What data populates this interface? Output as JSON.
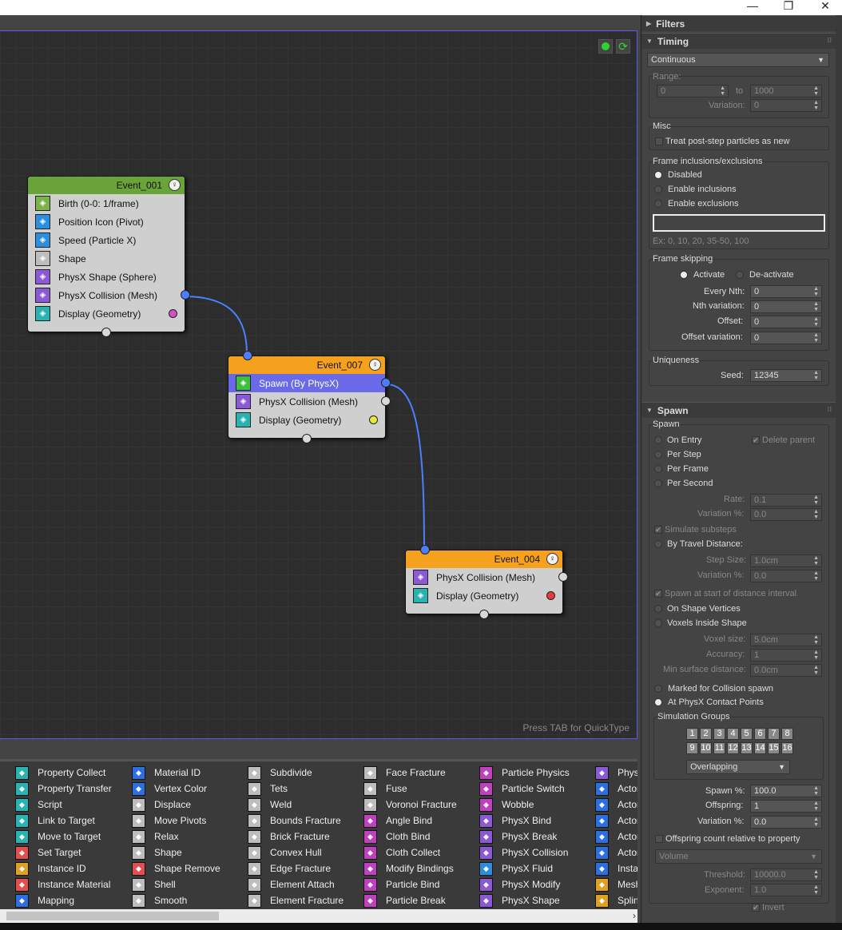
{
  "window": {
    "minimize": "—",
    "restore": "❐",
    "close": "✕"
  },
  "canvas": {
    "quicktype_hint": "Press TAB for QuickType"
  },
  "nodes": [
    {
      "id": "event_001",
      "title": "Event_001",
      "head_color": "#6aa337",
      "operators": [
        {
          "label": "Birth (0-0: 1/frame)",
          "icon": "birth-icon",
          "icon_color": "#7bb34a"
        },
        {
          "label": "Position Icon (Pivot)",
          "icon": "position-icon",
          "icon_color": "#2b8fe0"
        },
        {
          "label": "Speed (Particle X)",
          "icon": "speed-icon",
          "icon_color": "#2b8fe0"
        },
        {
          "label": "Shape",
          "icon": "shape-icon",
          "icon_color": "#bdbdbd"
        },
        {
          "label": "PhysX Shape (Sphere)",
          "icon": "physx-shape-icon",
          "icon_color": "#8b58d6"
        },
        {
          "label": "PhysX Collision (Mesh)",
          "icon": "physx-collision-icon",
          "icon_color": "#8b58d6"
        },
        {
          "label": "Display (Geometry)",
          "icon": "display-icon",
          "icon_color": "#29b2b2"
        }
      ],
      "display_color": "#d64ec9"
    },
    {
      "id": "event_007",
      "title": "Event_007",
      "head_color": "#f5a11e",
      "operators": [
        {
          "label": "Spawn (By PhysX)",
          "icon": "spawn-icon",
          "icon_color": "#3fbf3f",
          "selected": true
        },
        {
          "label": "PhysX Collision (Mesh)",
          "icon": "physx-collision-icon",
          "icon_color": "#8b58d6"
        },
        {
          "label": "Display (Geometry)",
          "icon": "display-icon",
          "icon_color": "#29b2b2"
        }
      ],
      "display_color": "#e8e83a"
    },
    {
      "id": "event_004",
      "title": "Event_004",
      "head_color": "#f5a11e",
      "operators": [
        {
          "label": "PhysX Collision (Mesh)",
          "icon": "physx-collision-icon",
          "icon_color": "#8b58d6"
        },
        {
          "label": "Display (Geometry)",
          "icon": "display-icon",
          "icon_color": "#29b2b2"
        }
      ],
      "display_color": "#e83a3a"
    }
  ],
  "depot": {
    "columns": [
      [
        {
          "label": "Property Collect",
          "c": "#2ab3b3"
        },
        {
          "label": "Property Transfer",
          "c": "#2ab3b3"
        },
        {
          "label": "Script",
          "c": "#2ab3b3"
        },
        {
          "label": "Link to Target",
          "c": "#2ab3b3"
        },
        {
          "label": "Move to Target",
          "c": "#2ab3b3"
        },
        {
          "label": "Set Target",
          "c": "#e05050"
        },
        {
          "label": "Instance ID",
          "c": "#e0a020"
        },
        {
          "label": "Instance Material",
          "c": "#e05050"
        },
        {
          "label": "Mapping",
          "c": "#2b6fe0"
        }
      ],
      [
        {
          "label": "Material ID",
          "c": "#2b6fe0"
        },
        {
          "label": "Vertex Color",
          "c": "#2b6fe0"
        },
        {
          "label": "Displace",
          "c": "#bdbdbd"
        },
        {
          "label": "Move Pivots",
          "c": "#bdbdbd"
        },
        {
          "label": "Relax",
          "c": "#bdbdbd"
        },
        {
          "label": "Shape",
          "c": "#bdbdbd"
        },
        {
          "label": "Shape Remove",
          "c": "#e05050"
        },
        {
          "label": "Shell",
          "c": "#bdbdbd"
        },
        {
          "label": "Smooth",
          "c": "#bdbdbd"
        }
      ],
      [
        {
          "label": "Subdivide",
          "c": "#bdbdbd"
        },
        {
          "label": "Tets",
          "c": "#bdbdbd"
        },
        {
          "label": "Weld",
          "c": "#bdbdbd"
        },
        {
          "label": "Bounds Fracture",
          "c": "#bdbdbd"
        },
        {
          "label": "Brick Fracture",
          "c": "#bdbdbd"
        },
        {
          "label": "Convex Hull",
          "c": "#bdbdbd"
        },
        {
          "label": "Edge Fracture",
          "c": "#bdbdbd"
        },
        {
          "label": "Element Attach",
          "c": "#bdbdbd"
        },
        {
          "label": "Element Fracture",
          "c": "#bdbdbd"
        }
      ],
      [
        {
          "label": "Face Fracture",
          "c": "#bdbdbd"
        },
        {
          "label": "Fuse",
          "c": "#bdbdbd"
        },
        {
          "label": "Voronoi Fracture",
          "c": "#bdbdbd"
        },
        {
          "label": "Angle Bind",
          "c": "#c040c0"
        },
        {
          "label": "Cloth Bind",
          "c": "#c040c0"
        },
        {
          "label": "Cloth Collect",
          "c": "#c040c0"
        },
        {
          "label": "Modify Bindings",
          "c": "#c040c0"
        },
        {
          "label": "Particle Bind",
          "c": "#c040c0"
        },
        {
          "label": "Particle Break",
          "c": "#c040c0"
        }
      ],
      [
        {
          "label": "Particle Physics",
          "c": "#c040c0"
        },
        {
          "label": "Particle Switch",
          "c": "#c040c0"
        },
        {
          "label": "Wobble",
          "c": "#c040c0"
        },
        {
          "label": "PhysX Bind",
          "c": "#8b58d6"
        },
        {
          "label": "PhysX Break",
          "c": "#8b58d6"
        },
        {
          "label": "PhysX Collision",
          "c": "#8b58d6"
        },
        {
          "label": "PhysX Fluid",
          "c": "#2b8fe0"
        },
        {
          "label": "PhysX Modify",
          "c": "#8b58d6"
        },
        {
          "label": "PhysX Shape",
          "c": "#8b58d6"
        }
      ],
      [
        {
          "label": "PhysX",
          "c": "#8b58d6"
        },
        {
          "label": "Actor",
          "c": "#2b6fe0"
        },
        {
          "label": "Actor",
          "c": "#2b6fe0"
        },
        {
          "label": "Actor",
          "c": "#2b6fe0"
        },
        {
          "label": "Actor",
          "c": "#2b6fe0"
        },
        {
          "label": "Actor",
          "c": "#2b6fe0"
        },
        {
          "label": "Instan",
          "c": "#2b6fe0"
        },
        {
          "label": "Mesh",
          "c": "#e0a020"
        },
        {
          "label": "Splin",
          "c": "#e0a020"
        }
      ]
    ],
    "scroll_right": "›"
  },
  "panel": {
    "filters": {
      "title": "Filters"
    },
    "timing": {
      "title": "Timing",
      "mode": "Continuous",
      "range_label": "Range:",
      "range_from": "0",
      "to_label": "to",
      "range_to": "1000",
      "variation_label": "Variation:",
      "variation": "0",
      "misc_label": "Misc",
      "treat_post_step": "Treat post-step particles as new",
      "frame_inc_label": "Frame inclusions/exclusions",
      "disabled": "Disabled",
      "enable_inclusions": "Enable inclusions",
      "enable_exclusions": "Enable exclusions",
      "ex_hint": "Ex: 0, 10, 20, 35-50, 100",
      "frame_skip_label": "Frame skipping",
      "activate": "Activate",
      "deactivate": "De-activate",
      "every_nth_label": "Every Nth:",
      "every_nth": "0",
      "nth_var_label": "Nth variation:",
      "nth_var": "0",
      "offset_label": "Offset:",
      "offset": "0",
      "offset_var_label": "Offset variation:",
      "offset_var": "0",
      "uniqueness_label": "Uniqueness",
      "seed_label": "Seed:",
      "seed": "12345"
    },
    "spawn": {
      "title": "Spawn",
      "group_label": "Spawn",
      "on_entry": "On Entry",
      "delete_parent": "Delete parent",
      "per_step": "Per Step",
      "per_frame": "Per Frame",
      "per_second": "Per Second",
      "rate_label": "Rate:",
      "rate": "0.1",
      "variation_pct_label": "Variation %:",
      "variation_pct": "0.0",
      "simulate_substeps": "Simulate substeps",
      "by_travel": "By Travel Distance:",
      "step_size_label": "Step Size:",
      "step_size": "1.0cm",
      "variation_pct2_label": "Variation %:",
      "variation_pct2": "0.0",
      "spawn_start": "Spawn at start of distance interval",
      "on_shape_vertices": "On Shape Vertices",
      "voxels_inside": "Voxels Inside Shape",
      "voxel_size_label": "Voxel size:",
      "voxel_size": "5.0cm",
      "accuracy_label": "Accuracy:",
      "accuracy": "1",
      "min_surface_label": "Min surface distance:",
      "min_surface": "0.0cm",
      "marked_collision": "Marked for Collision spawn",
      "at_physx_contact": "At PhysX Contact Points",
      "sim_groups_label": "Simulation Groups",
      "groups_row1": [
        "1",
        "2",
        "3",
        "4",
        "5",
        "6",
        "7",
        "8"
      ],
      "groups_row2": [
        "9",
        "10",
        "11",
        "12",
        "13",
        "14",
        "15",
        "16"
      ],
      "overlap_mode": "Overlapping",
      "spawn_pct_label": "Spawn %:",
      "spawn_pct": "100.0",
      "offspring_label": "Offspring:",
      "offspring": "1",
      "variation_pct3_label": "Variation %:",
      "variation_pct3": "0.0",
      "offspring_relative": "Offspring count relative to property",
      "volume": "Volume",
      "threshold_label": "Threshold:",
      "threshold": "10000.0",
      "exponent_label": "Exponent:",
      "exponent": "1.0",
      "invert": "Invert"
    }
  },
  "colors": {
    "wire": "#4b7fff",
    "selection": "#6a6ae8",
    "canvas_border": "#5a5ae6"
  }
}
